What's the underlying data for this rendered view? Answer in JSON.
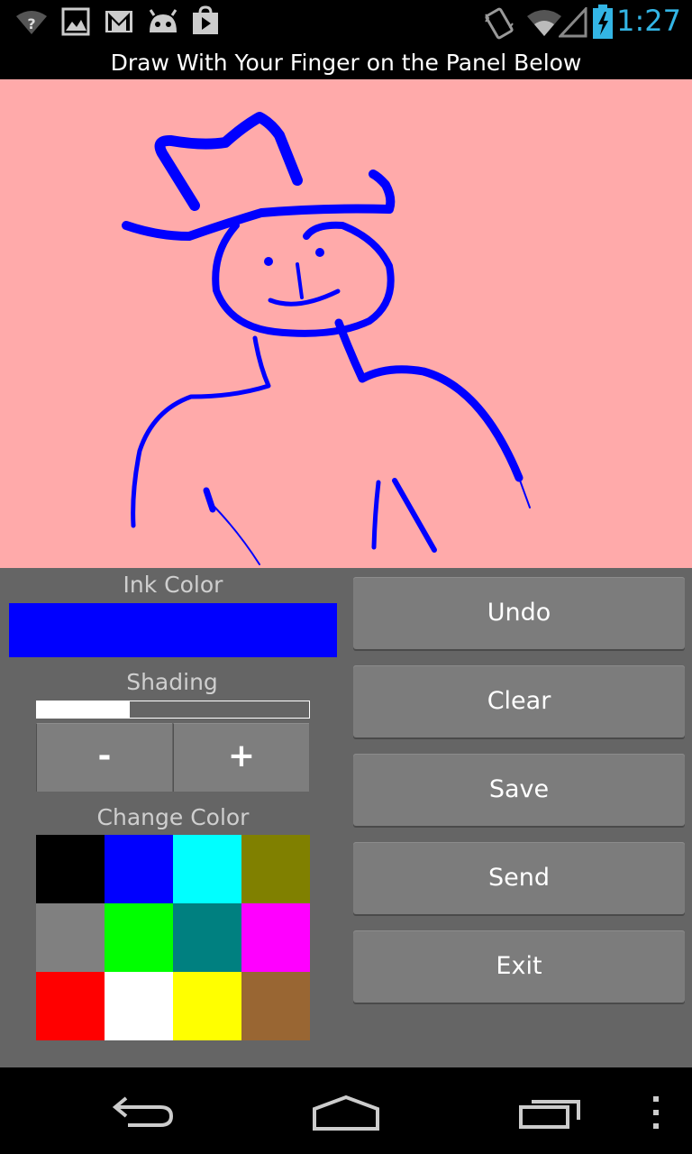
{
  "status_bar": {
    "time": "1:27",
    "icons": [
      "wifi-question-icon",
      "image-icon",
      "gmail-icon",
      "android-icon",
      "play-store-icon",
      "vibrate-icon",
      "wifi-icon",
      "signal-icon",
      "battery-charging-icon"
    ]
  },
  "header": {
    "title": "Draw With Your Finger on the Panel Below"
  },
  "canvas": {
    "background": "#ffaaaa",
    "ink_color": "#0000ff"
  },
  "controls": {
    "ink_label": "Ink Color",
    "ink_color": "#0000ff",
    "shading_label": "Shading",
    "shading_level": 0.34,
    "minus_label": "-",
    "plus_label": "+",
    "change_color_label": "Change Color",
    "palette": [
      "#000000",
      "#0000ff",
      "#00ffff",
      "#808000",
      "#808080",
      "#00ff00",
      "#008080",
      "#ff00ff",
      "#ff0000",
      "#ffffff",
      "#ffff00",
      "#996633"
    ]
  },
  "buttons": {
    "undo": "Undo",
    "clear": "Clear",
    "save": "Save",
    "send": "Send",
    "exit": "Exit"
  },
  "nav_bar": {
    "icons": [
      "back-icon",
      "home-icon",
      "recents-icon",
      "menu-icon"
    ]
  }
}
